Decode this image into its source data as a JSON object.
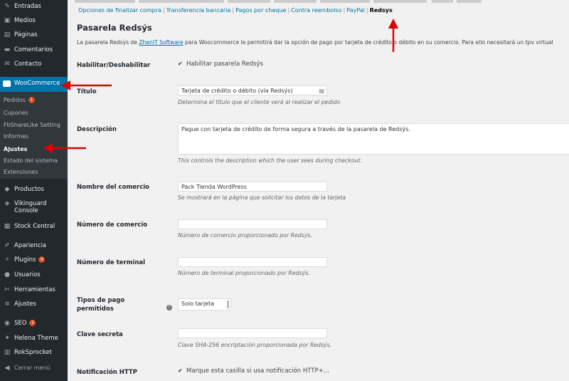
{
  "sidebar": {
    "entradas": "Entradas",
    "medios": "Medios",
    "paginas": "Páginas",
    "comentarios": "Comentarios",
    "contacto": "Contacto",
    "woocommerce": "WooCommerce",
    "submenu": {
      "pedidos": "Pedidos",
      "pedidos_count": "1",
      "cupones": "Cupones",
      "fbsharelike": "FbShareLike Setting",
      "informes": "Informes",
      "ajustes": "Ajustes",
      "estado": "Estado del sistema",
      "extensiones": "Extensiones"
    },
    "productos": "Productos",
    "vikinguard_line1": "Vikinguard",
    "vikinguard_line2": "Console",
    "stock": "Stock Central",
    "apariencia": "Apariencia",
    "plugins": "Plugins",
    "plugins_count": "9",
    "usuarios": "Usuarios",
    "herramientas": "Herramientas",
    "ajustes": "Ajustes",
    "seo": "SEO",
    "seo_count": "3",
    "helena": "Helena Theme",
    "roksprocket": "RokSprocket",
    "cerrar": "Cerrar menú"
  },
  "subsub": {
    "opciones": "Opciones de finalizar compra",
    "transferencia": "Transferencia bancaria",
    "cheque": "Pagos por cheque",
    "reembolso": "Contra reembolso",
    "paypal": "PayPal",
    "redsys": "Redsys",
    "sep": "|"
  },
  "page": {
    "title": "Pasarela Redsýs",
    "desc_before": "La pasarela Redsýs de ",
    "desc_link": "ZhenIT Software",
    "desc_after": " para Woocommerce le permitirá dar la opción de pago por tarjeta de crédito o débito en su comercio. Para ello necesitará un tpv virtual"
  },
  "fields": {
    "habilitar_label": "Habilitar/Deshabilitar",
    "habilitar_checkbox": "Habilitar pasarela Redsýs",
    "titulo_label": "Título",
    "titulo_value": "Tarjeta de crédito o débito (vía Redsýs)",
    "titulo_hint": "Determina el título que el cliente verá al realizar el pedido",
    "descripcion_label": "Descripción",
    "descripcion_value": "Pague con tarjeta de crédito de forma segura a través de la pasarela de Redsýs.",
    "descripcion_hint": "This controls the description which the user sees during checkout.",
    "nombre_label": "Nombre del comercio",
    "nombre_value": "Pack Tienda WordPress",
    "nombre_hint": "Se mostrará en la página que solicitar los datos de la tarjeta",
    "numcomercio_label": "Número de comercio",
    "numcomercio_value": "",
    "numcomercio_hint": "Número de comercio proporcionado por Redsýs.",
    "numterminal_label": "Número de terminal",
    "numterminal_value": "",
    "numterminal_hint": "Número de terminal proporcionado por Redsýs.",
    "tipos_label_1": "Tipos de pago",
    "tipos_label_2": "permitidos",
    "tipos_value": "Solo tarjeta",
    "clave_label": "Clave secreta",
    "clave_value": "",
    "clave_hint": "Clave SHA-256 encriptación proporcionada por Redsýs.",
    "notif_label": "Notificación HTTP",
    "notif_checkbox": "Marque esta casilla si usa notificación HTTP+..."
  },
  "colors": {
    "sidebar_bg": "#23282d",
    "accent": "#0073aa",
    "badge": "#d54e21",
    "arrow": "#e00000"
  },
  "icons": {
    "entradas": "pin-icon",
    "medios": "media-icon",
    "paginas": "page-icon",
    "comentarios": "comment-icon",
    "contacto": "mail-icon",
    "woocommerce": "woo-icon",
    "productos": "box-icon",
    "vikinguard": "shield-icon",
    "stock": "archive-icon",
    "apariencia": "brush-icon",
    "plugins": "plug-icon",
    "usuarios": "user-icon",
    "herramientas": "wrench-icon",
    "ajustes": "sliders-icon",
    "seo": "seo-icon",
    "helena": "star-icon",
    "roksprocket": "sprocket-icon",
    "cerrar": "collapse-icon"
  }
}
